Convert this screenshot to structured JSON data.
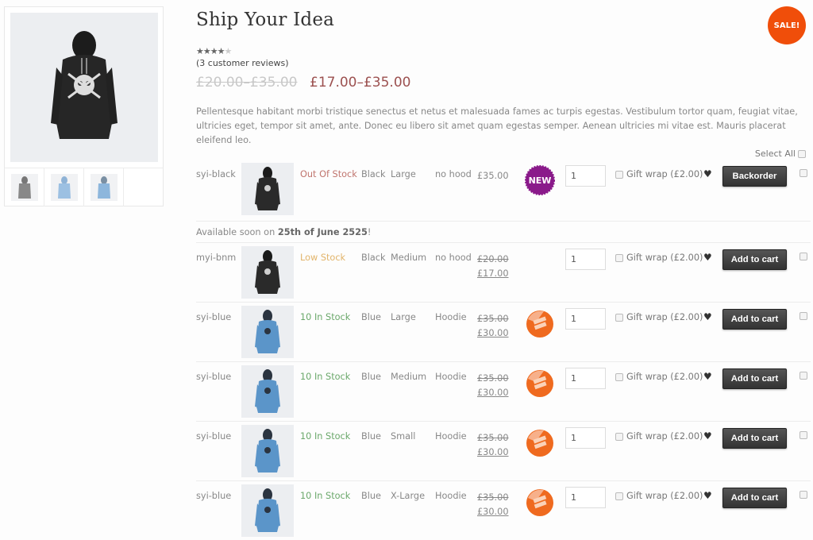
{
  "product": {
    "title": "Ship Your Idea",
    "sale_badge": "SALE!",
    "rating": 4,
    "rating_max": 5,
    "reviews_label": "(3 customer reviews)",
    "price_old": "£20.00–£35.00",
    "price_new": "£17.00–£35.00",
    "description": "Pellentesque habitant morbi tristique senectus et netus et malesuada fames ac turpis egestas. Vestibulum tortor quam, feugiat vitae, ultricies eget, tempor sit amet, ante. Donec eu libero sit amet quam egestas semper. Aenean ultricies mi vitae est. Mauris placerat eleifend leo."
  },
  "gallery": {
    "thumbnails": [
      "grey-hoodie",
      "light-blue-hoodie",
      "blue-hoodie"
    ]
  },
  "table": {
    "select_all_label": "Select All",
    "gift_wrap_label": "Gift wrap (£2.00)",
    "availability_note_prefix": "Available soon on ",
    "availability_note_date": "25th of June 2525",
    "availability_note_suffix": "!",
    "rows": [
      {
        "sku": "syi-black",
        "stock": "Out Of Stock",
        "stock_color": "#c0756e",
        "color": "Black",
        "size": "Large",
        "style": "no hood",
        "price_old": "",
        "price": "£35.00",
        "badge": "NEW",
        "qty": "1",
        "button": "Backorder",
        "image": "black-hoodie"
      },
      {
        "sku": "myi-bnm",
        "stock": "Low Stock",
        "stock_color": "#e2b46a",
        "color": "Black",
        "size": "Medium",
        "style": "no hood",
        "price_old": "£20.00",
        "price": "£17.00",
        "badge": "",
        "qty": "1",
        "button": "Add to cart",
        "image": "black-hoodie"
      },
      {
        "sku": "syi-blue",
        "stock": "10 In Stock",
        "stock_color": "#6aa86a",
        "color": "Blue",
        "size": "Large",
        "style": "Hoodie",
        "price_old": "£35.00",
        "price": "£30.00",
        "badge": "SPECIAL OFFER",
        "qty": "1",
        "button": "Add to cart",
        "image": "blue-hoodie"
      },
      {
        "sku": "syi-blue",
        "stock": "10 In Stock",
        "stock_color": "#6aa86a",
        "color": "Blue",
        "size": "Medium",
        "style": "Hoodie",
        "price_old": "£35.00",
        "price": "£30.00",
        "badge": "SPECIAL OFFER",
        "qty": "1",
        "button": "Add to cart",
        "image": "blue-hoodie"
      },
      {
        "sku": "syi-blue",
        "stock": "10 In Stock",
        "stock_color": "#6aa86a",
        "color": "Blue",
        "size": "Small",
        "style": "Hoodie",
        "price_old": "£35.00",
        "price": "£30.00",
        "badge": "SPECIAL OFFER",
        "qty": "1",
        "button": "Add to cart",
        "image": "blue-hoodie"
      },
      {
        "sku": "syi-blue",
        "stock": "10 In Stock",
        "stock_color": "#6aa86a",
        "color": "Blue",
        "size": "X-Large",
        "style": "Hoodie",
        "price_old": "£35.00",
        "price": "£30.00",
        "badge": "SPECIAL OFFER",
        "qty": "1",
        "button": "Add to cart",
        "image": "blue-hoodie"
      }
    ]
  },
  "colors": {
    "sale_badge": "#f04e0a",
    "new_badge": "#8a1a8a",
    "offer_badge": "#ef6a1f",
    "price_new": "#9c5150",
    "button": "#444444"
  }
}
